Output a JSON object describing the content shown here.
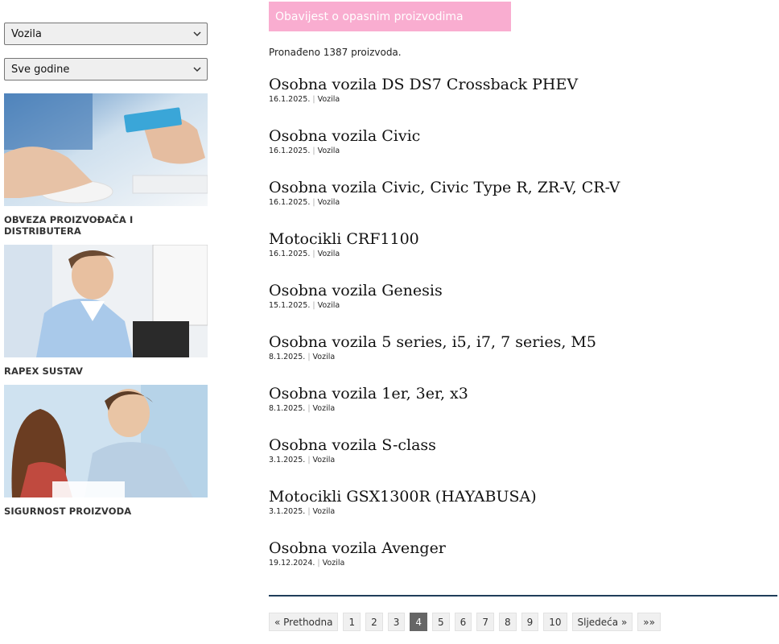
{
  "filters": {
    "category": "Vozila",
    "year": "Sve godine"
  },
  "promos": [
    {
      "caption": "OBVEZA PROIZVOĐAČA I DISTRIBUTERA"
    },
    {
      "caption": "RAPEX SUSTAV"
    },
    {
      "caption": "SIGURNOST PROIZVODA"
    }
  ],
  "banner": {
    "label": "Obavijest o opasnim proizvodima"
  },
  "results": {
    "count_text": "Pronađeno 1387 proizvoda."
  },
  "items": [
    {
      "title": "Osobna vozila DS DS7 Crossback PHEV",
      "date": "16.1.2025.",
      "category": "Vozila"
    },
    {
      "title": "Osobna vozila Civic",
      "date": "16.1.2025.",
      "category": "Vozila"
    },
    {
      "title": "Osobna vozila Civic, Civic Type R, ZR-V, CR-V",
      "date": "16.1.2025.",
      "category": "Vozila"
    },
    {
      "title": "Motocikli CRF1100",
      "date": "16.1.2025.",
      "category": "Vozila"
    },
    {
      "title": "Osobna vozila Genesis",
      "date": "15.1.2025.",
      "category": "Vozila"
    },
    {
      "title": "Osobna vozila 5 series, i5, i7, 7 series, M5",
      "date": "8.1.2025.",
      "category": "Vozila"
    },
    {
      "title": "Osobna vozila 1er, 3er, x3",
      "date": "8.1.2025.",
      "category": "Vozila"
    },
    {
      "title": "Osobna vozila S-class",
      "date": "3.1.2025.",
      "category": "Vozila"
    },
    {
      "title": "Motocikli GSX1300R (HAYABUSA)",
      "date": "3.1.2025.",
      "category": "Vozila"
    },
    {
      "title": "Osobna vozila Avenger",
      "date": "19.12.2024.",
      "category": "Vozila"
    }
  ],
  "meta_separator": "|",
  "pagination": {
    "prev": "« Prethodna",
    "pages": [
      "1",
      "2",
      "3",
      "4",
      "5",
      "6",
      "7",
      "8",
      "9",
      "10"
    ],
    "current": "4",
    "next": "Sljedeća »",
    "last": "»»"
  }
}
